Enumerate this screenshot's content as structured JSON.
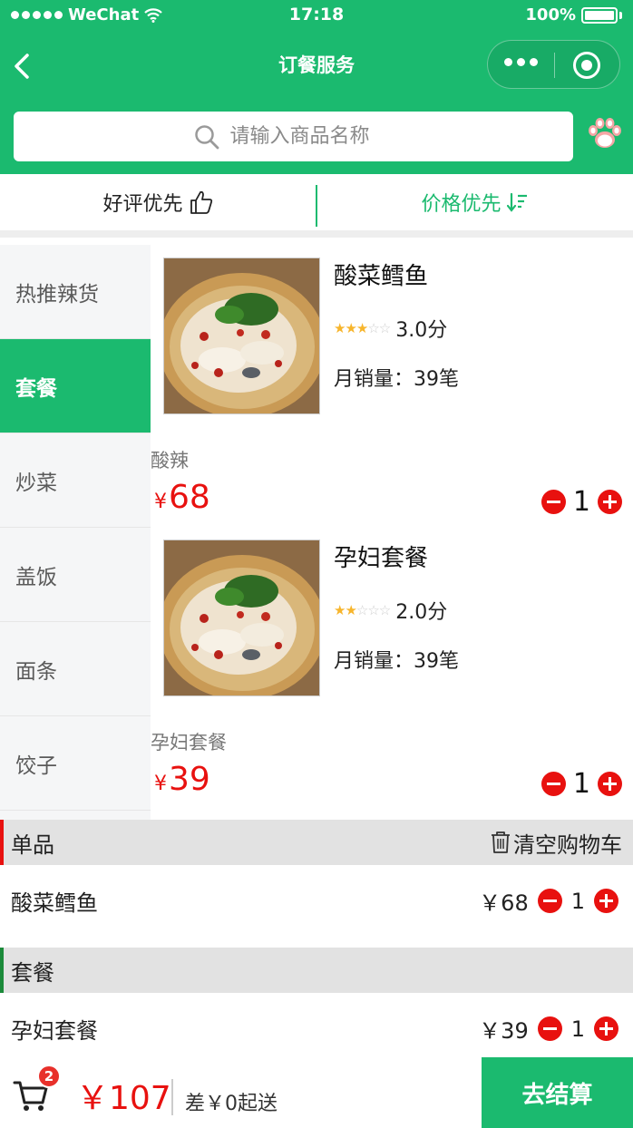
{
  "status_bar": {
    "carrier": "WeChat",
    "time": "17:18",
    "battery": "100%"
  },
  "nav": {
    "title": "订餐服务"
  },
  "search": {
    "placeholder": "请输入商品名称"
  },
  "sort": {
    "rating_label": "好评优先",
    "price_label": "价格优先"
  },
  "categories": [
    {
      "label": "热推辣货"
    },
    {
      "label": "套餐"
    },
    {
      "label": "炒菜"
    },
    {
      "label": "盖饭"
    },
    {
      "label": "面条"
    },
    {
      "label": "饺子"
    }
  ],
  "products": [
    {
      "name": "酸菜鳕鱼",
      "rating": 3,
      "score": "3.0分",
      "sales": "月销量：39笔",
      "desc": "酸辣",
      "currency": "¥",
      "price": "68",
      "qty": "1"
    },
    {
      "name": "孕妇套餐",
      "rating": 2,
      "score": "2.0分",
      "sales": "月销量：39笔",
      "desc": "孕妇套餐",
      "currency": "¥",
      "price": "39",
      "qty": "1"
    }
  ],
  "cart": {
    "clear_label": "清空购物车",
    "groups": [
      {
        "title": "单品",
        "accent": "#e8110f",
        "item": {
          "name": "酸菜鳕鱼",
          "price": "￥68",
          "qty": "1"
        }
      },
      {
        "title": "套餐",
        "accent": "#1b8a3a",
        "item": {
          "name": "孕妇套餐",
          "price": "￥39",
          "qty": "1"
        }
      }
    ]
  },
  "bottom": {
    "badge": "2",
    "total": "￥107",
    "min_note": "差￥0起送",
    "checkout": "去结算"
  },
  "colors": {
    "brand": "#1bba6f",
    "price": "#e8110f",
    "star": "#f7b52c"
  }
}
